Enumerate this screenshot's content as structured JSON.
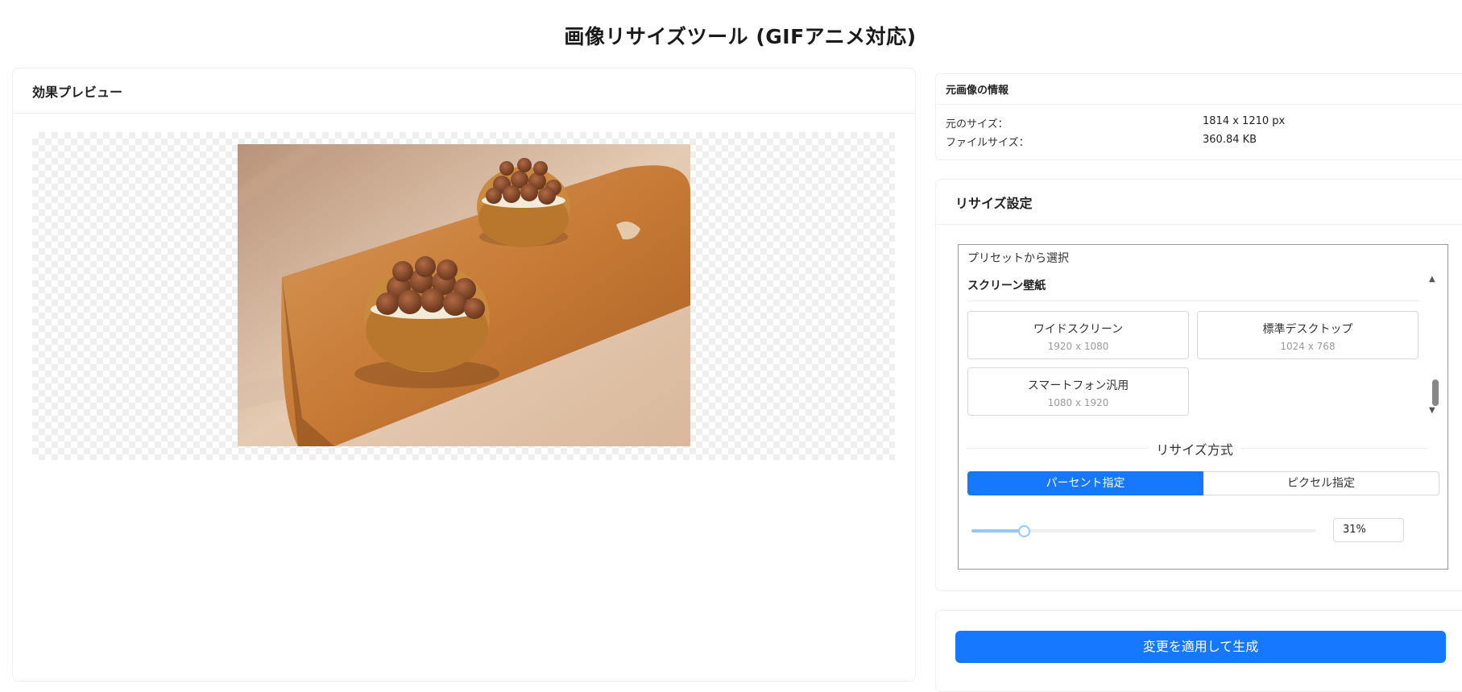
{
  "page": {
    "title": "画像リサイズツール (GIFアニメ対応)"
  },
  "preview": {
    "title": "効果プレビュー"
  },
  "info": {
    "title": "元画像の情報",
    "size_label": "元のサイズ：",
    "size_value": "1814 x 1210 px",
    "filesize_label": "ファイルサイズ：",
    "filesize_value": "360.84 KB"
  },
  "resize": {
    "title": "リサイズ設定",
    "preset_label": "プリセットから選択",
    "group_title": "スクリーン壁紙",
    "presets": [
      {
        "name": "ワイドスクリーン",
        "dim": "1920 x 1080"
      },
      {
        "name": "標準デスクトップ",
        "dim": "1024 x 768"
      },
      {
        "name": "スマートフォン汎用",
        "dim": "1080 x 1920"
      }
    ],
    "method_title": "リサイズ方式",
    "method_percent": "パーセント指定",
    "method_pixel": "ピクセル指定",
    "active_method": "パーセント指定",
    "slider_percent": 31,
    "percent_value": "31%"
  },
  "generate": {
    "label": "変更を適用して生成"
  },
  "colors": {
    "accent": "#1677ff",
    "slider": "#91caff"
  },
  "icons": {
    "scroll_up": "triangle-up-icon",
    "scroll_down": "triangle-down-icon"
  }
}
